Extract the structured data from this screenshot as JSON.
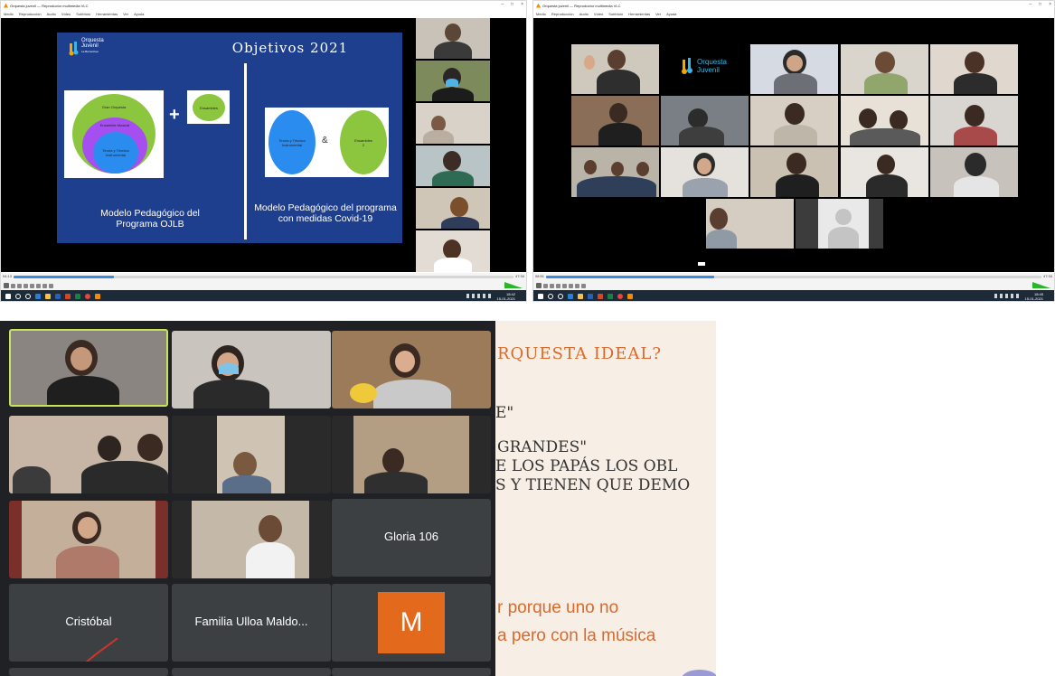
{
  "left_window": {
    "title": "Orquesta juvenil — Reproductor multimedia VLC",
    "menu": [
      "Medio",
      "Reproducción",
      "Audio",
      "Vídeo",
      "Subtítulo",
      "Herramientas",
      "Ver",
      "Ayuda"
    ],
    "time_elapsed": "04:13",
    "time_total": "47:34",
    "progress": 0.2,
    "slide": {
      "logo_line1": "Orquesta",
      "logo_line2": "Juvenil",
      "logo_line3": "La Barnechea",
      "title": "Objetivos 2021",
      "box_ensambles": "Ensambles",
      "circle_outer": "Gran Orquesta",
      "circle_middle": "Ensamble Musical",
      "circle_inner": "Teoría y Técnica Instrumental",
      "circle_teoria": "Teoría y Técnica Instrumental",
      "circle_ensambles": "Ensambles",
      "ensambles_sub": "2",
      "amp": "&",
      "caption_left": "Modelo Pedagógico del Programa OJLB",
      "caption_right": "Modelo Pedagógico del programa con medidas Covid-19"
    },
    "clock_time": "18:42",
    "clock_date": "15-01-2021"
  },
  "right_window": {
    "title": "Orquesta juvenil — Reproductor multimedia VLC",
    "menu": [
      "Medio",
      "Reproducción",
      "Audio",
      "Vídeo",
      "Subtítulo",
      "Herramientas",
      "Ver",
      "Ayuda"
    ],
    "time_elapsed": "08:51",
    "time_total": "47:34",
    "progress": 0.34,
    "logo_line1": "Orquesta",
    "logo_line2": "Juvenil",
    "clock_time": "18:45",
    "clock_date": "15-01-2021"
  },
  "meet": {
    "tiles": [
      {
        "name": "Gloria 106"
      },
      {
        "name": "Cristóbal"
      },
      {
        "name": "Familia Ulloa Maldo..."
      },
      {
        "avatar": "M"
      }
    ]
  },
  "right_slide": {
    "line1": "RQUESTA IDEAL?",
    "line2": "E\"",
    "line3": "GRANDES\"",
    "line4": "E LOS PAPÁS LOS OBL",
    "line5": "S Y TIENEN QUE DEMO",
    "line6": "r porque uno no",
    "line7": "a pero con la música"
  },
  "colors": {
    "slide_blue": "#1e3f8e",
    "circle_green": "#8cc63f",
    "circle_purple": "#a64ff0",
    "circle_blue": "#2b8cf0",
    "meet_bg": "#202124",
    "active_speaker": "#c7e35a",
    "avatar_orange": "#e36a1c",
    "slide_orange": "#d96a2b"
  }
}
